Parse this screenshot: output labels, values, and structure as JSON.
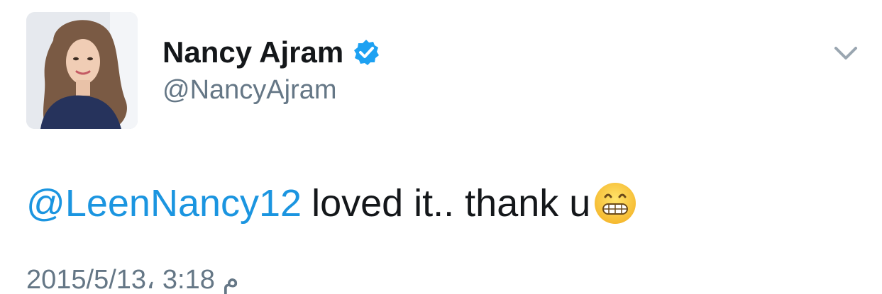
{
  "author": {
    "display_name": "Nancy Ajram",
    "handle": "@NancyAjram",
    "verified": true
  },
  "tweet": {
    "mention": "@LeenNancy12",
    "body": "loved it.. thank u",
    "emoji": "grinning-face-with-clenched-teeth",
    "timestamp": "م 3:18 ،2015/5/13"
  },
  "icons": {
    "menu": "chevron-down-icon",
    "verified": "verified-badge-icon"
  },
  "colors": {
    "link": "#1b95e0",
    "verified": "#1da1f2",
    "secondary_text": "#657786",
    "primary_text": "#14171a"
  }
}
